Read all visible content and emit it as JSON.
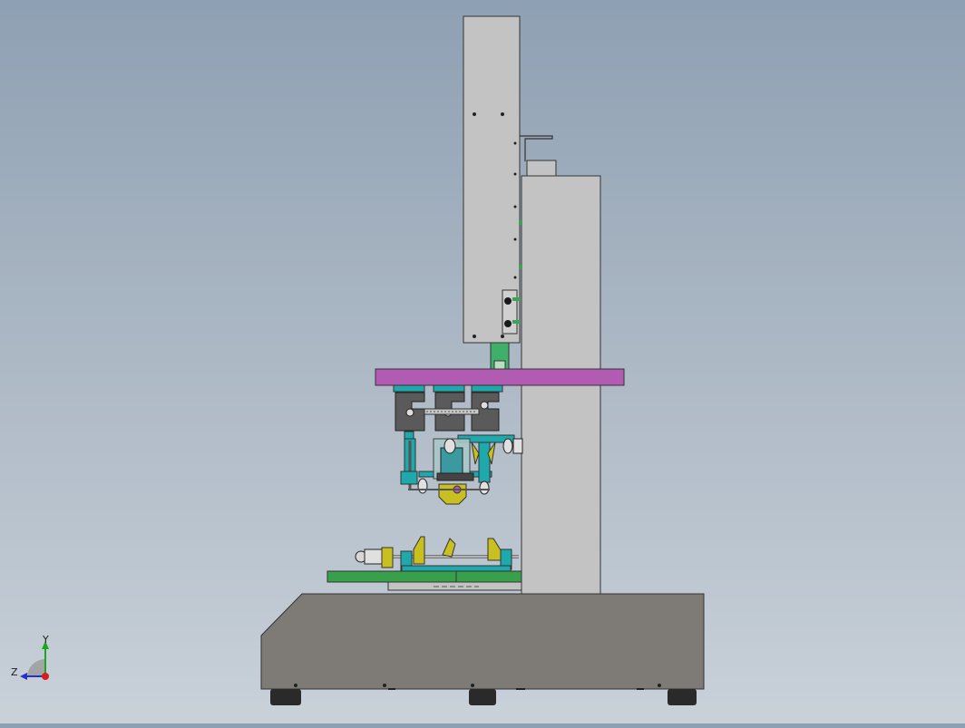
{
  "view": {
    "background_top": "#8ea0b3",
    "background_bottom": "#c9d1d9"
  },
  "colors": {
    "frame_gray": "#c3c3c3",
    "base_gray": "#7e7a76",
    "crossbar_magenta": "#b25bb2",
    "bed_green": "#38a04a",
    "bracket_cyan": "#1fa9ad",
    "clamp_yellow": "#c8c020",
    "loadcell_dark": "#5a5a5a",
    "foot_black": "#2a2a2a"
  },
  "triad": {
    "y_label": "Y",
    "z_label": "Z",
    "icons": [
      "y-axis-arrow-icon",
      "z-axis-arrow-icon",
      "origin-icon"
    ]
  }
}
